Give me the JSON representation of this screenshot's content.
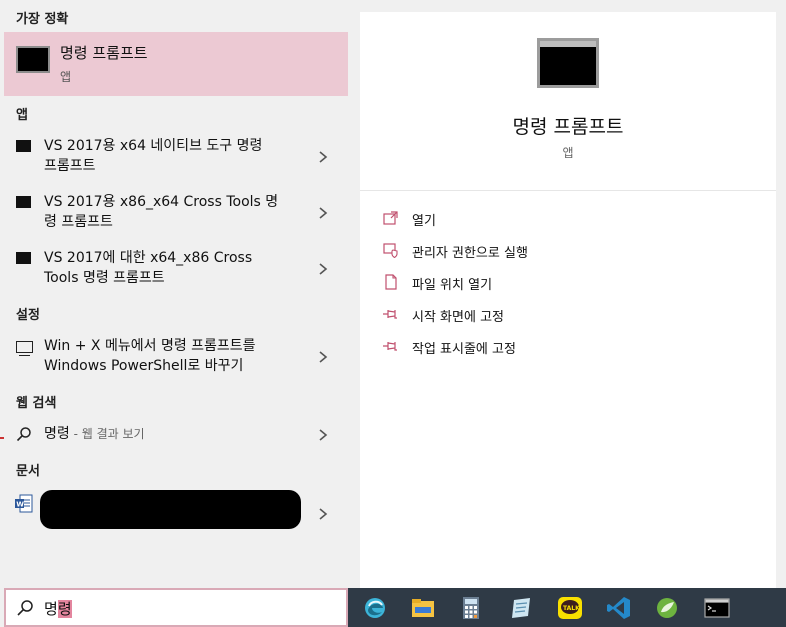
{
  "left": {
    "best_match": {
      "heading": "가장 정확",
      "name": "명령 프롬프트",
      "type": "앱"
    },
    "apps_heading": "앱",
    "apps": [
      {
        "line1": "VS 2017용 x64 네이티브 도구 명령",
        "line2": "프롬프트"
      },
      {
        "line1": "VS 2017용 x86_x64 Cross Tools 명",
        "line2": "령 프롬프트"
      },
      {
        "line1": "VS 2017에 대한 x64_x86 Cross",
        "line2": "Tools 명령 프롬프트"
      }
    ],
    "settings_heading": "설정",
    "settings": [
      {
        "line1": "Win + X 메뉴에서 명령 프롬프트를",
        "line2": "Windows PowerShell로 바꾸기"
      }
    ],
    "web_heading": "웹 검색",
    "web": {
      "query": "명령",
      "hint": " - 웹 결과 보기"
    },
    "docs_heading": "문서"
  },
  "right": {
    "name": "명령 프롬프트",
    "type": "앱",
    "actions": [
      "열기",
      "관리자 권한으로 실행",
      "파일 위치 열기",
      "시작 화면에 고정",
      "작업 표시줄에 고정"
    ]
  },
  "search": {
    "typed": "명",
    "composing": "령"
  },
  "colors": {
    "accent": "#e3859e",
    "selected_bg": "#ecc9d3",
    "taskbar": "#2f3a46"
  },
  "taskbar_icons": [
    "edge-icon",
    "file-explorer-icon",
    "calculator-icon",
    "notepad-icon",
    "kakaotalk-icon",
    "vscode-icon",
    "spring-icon",
    "cmd-icon"
  ]
}
